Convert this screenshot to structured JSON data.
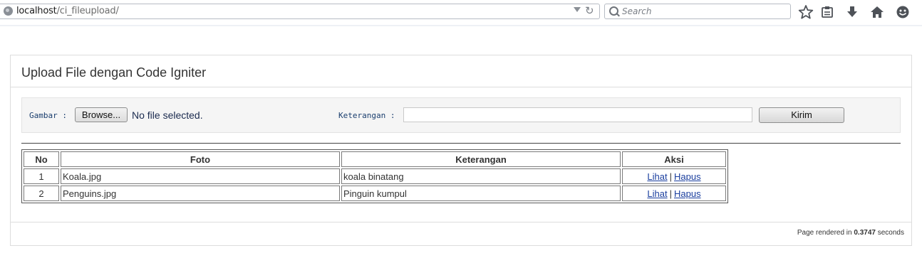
{
  "browser": {
    "url_host": "localhost",
    "url_path": "/ci_fileupload/",
    "search_placeholder": "Search",
    "reload_glyph": "↻",
    "icons": [
      "star-icon",
      "reading-list-icon",
      "download-icon",
      "home-icon",
      "smiley-icon"
    ]
  },
  "page": {
    "title": "Upload File dengan Code Igniter",
    "form": {
      "gambar_label": "Gambar :",
      "browse_label": "Browse...",
      "file_status": "No file selected.",
      "keterangan_label": "Keterangan :",
      "keterangan_value": "",
      "submit_label": "Kirim"
    },
    "table": {
      "headers": [
        "No",
        "Foto",
        "Keterangan",
        "Aksi"
      ],
      "rows": [
        {
          "no": "1",
          "foto": "Koala.jpg",
          "keterangan": "koala binatang",
          "lihat": "Lihat",
          "hapus": "Hapus"
        },
        {
          "no": "2",
          "foto": "Penguins.jpg",
          "keterangan": "Pinguin kumpul",
          "lihat": "Lihat",
          "hapus": "Hapus"
        }
      ],
      "separator": "|"
    },
    "footer": {
      "prefix": "Page rendered in",
      "time": "0.3747",
      "suffix": "seconds"
    }
  }
}
